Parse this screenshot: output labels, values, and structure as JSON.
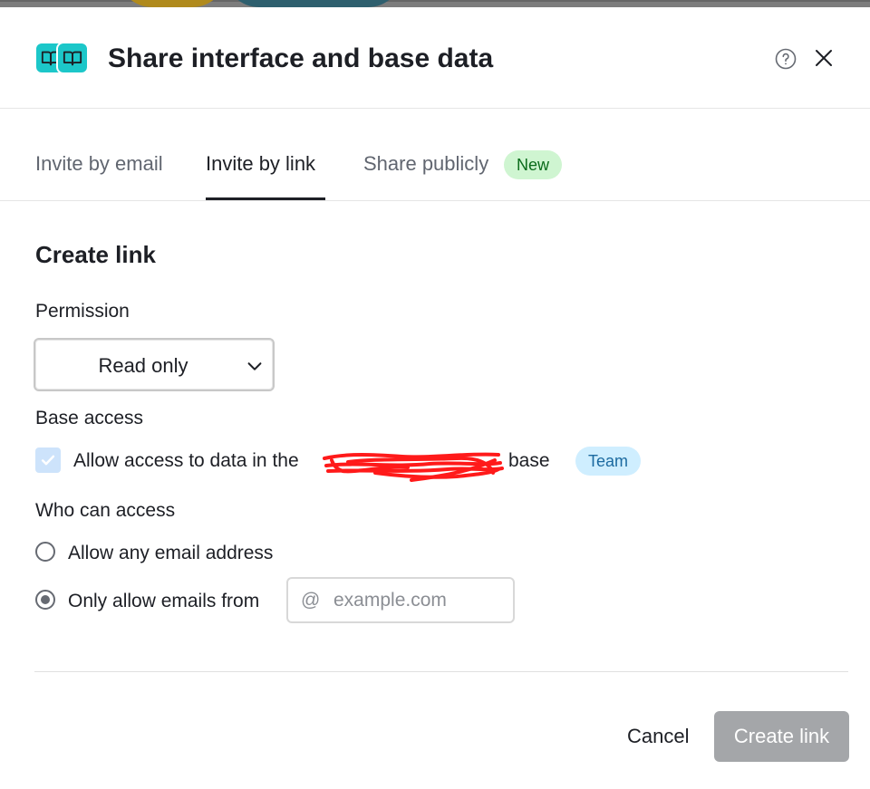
{
  "dialog": {
    "title": "Share interface and base data",
    "icon_name": "book-open-icon",
    "accent_color": "#1cc7c9"
  },
  "tabs": [
    {
      "label": "Invite by email",
      "active": false
    },
    {
      "label": "Invite by link",
      "active": true
    },
    {
      "label": "Share publicly",
      "active": false,
      "badge": "New"
    }
  ],
  "form": {
    "section_title": "Create link",
    "permission": {
      "label": "Permission",
      "selected": "Read only"
    },
    "base_access": {
      "label": "Base access",
      "checkbox_checked": true,
      "text_before": "Allow access to data in the",
      "text_after": "base",
      "badge": "Team"
    },
    "who_can_access": {
      "label": "Who can access",
      "options": [
        {
          "label": "Allow any email address",
          "selected": false
        },
        {
          "label": "Only allow emails from",
          "selected": true
        }
      ],
      "domain_prefix": "@",
      "domain_placeholder": "example.com",
      "domain_value": ""
    }
  },
  "footer": {
    "cancel_label": "Cancel",
    "create_label": "Create link",
    "create_enabled": false
  }
}
